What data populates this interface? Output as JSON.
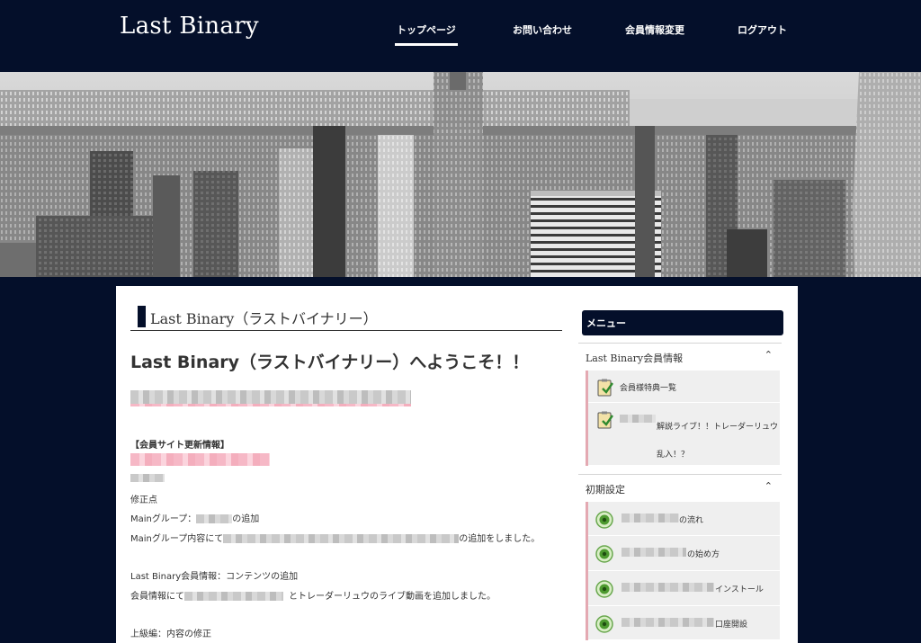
{
  "header": {
    "logo": "Last Binary",
    "nav": [
      {
        "label": "トップページ",
        "active": true
      },
      {
        "label": "お問い合わせ",
        "active": false
      },
      {
        "label": "会員情報変更",
        "active": false
      },
      {
        "label": "ログアウト",
        "active": false
      }
    ]
  },
  "main": {
    "page_title": "Last Binary（ラストバイナリー）",
    "welcome": "Last Binary（ラストバイナリー）へようこそ！！",
    "update_heading": "【会員サイト更新情報】",
    "lines": {
      "fix_point": "修正点",
      "main_group_prefix": "Mainグループ：",
      "main_group_suffix": "の追加",
      "main_group_content_prefix": "Mainグループ内容にて",
      "main_group_content_suffix": "の追加をしました。",
      "member_info_contents": "Last Binary会員情報：コンテンツの追加",
      "member_info_prefix": "会員情報にて",
      "member_info_suffix": "とトレーダーリュウのライブ動画を追加しました。",
      "advanced_fix": "上級編：内容の修正"
    }
  },
  "sidebar": {
    "menu_title": "メニュー",
    "sections": [
      {
        "title": "Last Binary会員情報",
        "items": [
          {
            "label": "会員様特典一覧"
          },
          {
            "label": "解説ライブ！！トレーダーリュウ乱入！？"
          }
        ]
      },
      {
        "title": "初期設定",
        "items": [
          {
            "label": "の流れ"
          },
          {
            "label": "の始め方"
          },
          {
            "label": "インストール"
          },
          {
            "label": "口座開設"
          }
        ]
      }
    ]
  },
  "colors": {
    "navy": "#040f2a",
    "pink_blur": "#f6b8c6",
    "sidebar_accent": "#e4a9b2"
  }
}
